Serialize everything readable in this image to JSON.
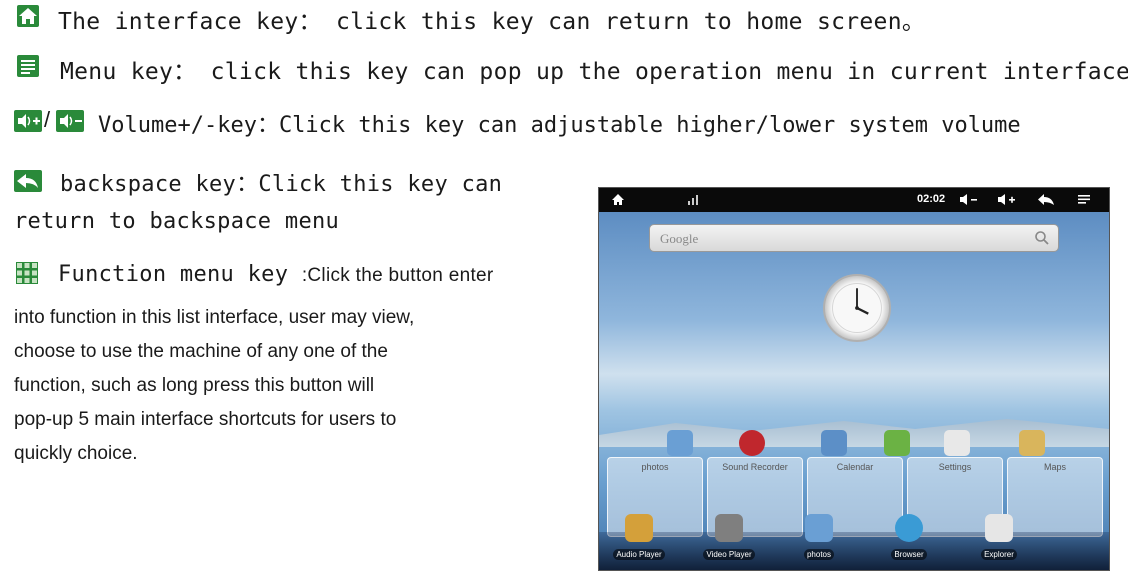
{
  "keys": {
    "home": {
      "icon": "home-icon",
      "text": "The interface key： click this key can return to home screen。"
    },
    "menu": {
      "icon": "menu-icon",
      "text": "Menu key： click this key can pop up the operation menu in current interface"
    },
    "volume": {
      "icon_separator": "/",
      "text": "Volume+/-key：Click this key can adjustable higher/lower system volume"
    },
    "back": {
      "text_line1": "backspace key：Click this key can",
      "text_line2": "return to backspace menu"
    },
    "function": {
      "label": "Function menu key",
      "lines": [
        ":Click the button enter",
        "into function in this list interface, user may view,",
        "choose to use the machine of any one of the",
        "function, such as long press this button will",
        "pop-up 5 main interface shortcuts for users to",
        "quickly choice."
      ]
    }
  },
  "tablet": {
    "status_time": "02:02",
    "search_placeholder": "Google",
    "panel_labels": [
      "photos",
      "Sound Recorder",
      "Calendar",
      "Settings",
      "",
      "Maps"
    ],
    "dock": [
      "Audio Player",
      "Video Player",
      "photos",
      "Browser",
      "Explorer"
    ]
  },
  "colors": {
    "icon_green": "#2f8f3c",
    "icon_dark": "#2b2b2b"
  }
}
